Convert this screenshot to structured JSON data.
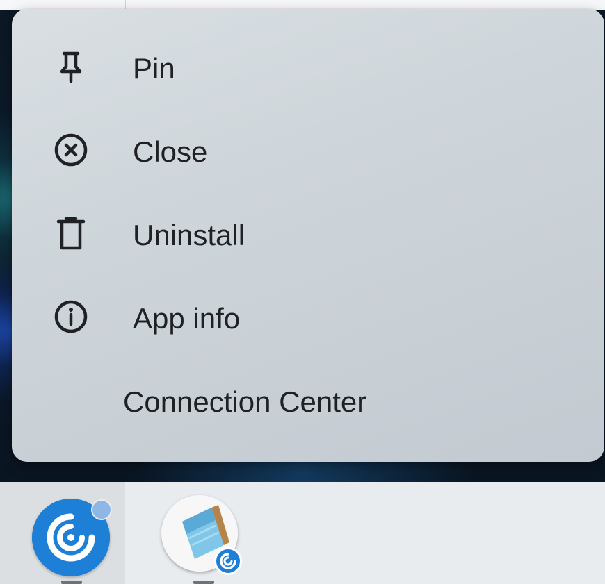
{
  "context_menu": {
    "items": [
      {
        "label": "Pin",
        "icon": "pin-icon"
      },
      {
        "label": "Close",
        "icon": "close-circle-icon"
      },
      {
        "label": "Uninstall",
        "icon": "trash-icon"
      },
      {
        "label": "App info",
        "icon": "info-icon"
      },
      {
        "label": "Connection Center",
        "icon": ""
      }
    ]
  },
  "shelf": {
    "apps": [
      {
        "name": "workspace-app",
        "icon": "spiral-icon",
        "active": true,
        "notification": true
      },
      {
        "name": "notepad-app",
        "icon": "notepad-icon",
        "active": false,
        "badge": "spiral-icon"
      }
    ]
  },
  "colors": {
    "menu_background": "#cfd6db",
    "menu_text": "#202124",
    "shelf_background": "#e9ecef",
    "app_accent": "#1e7fd6"
  }
}
